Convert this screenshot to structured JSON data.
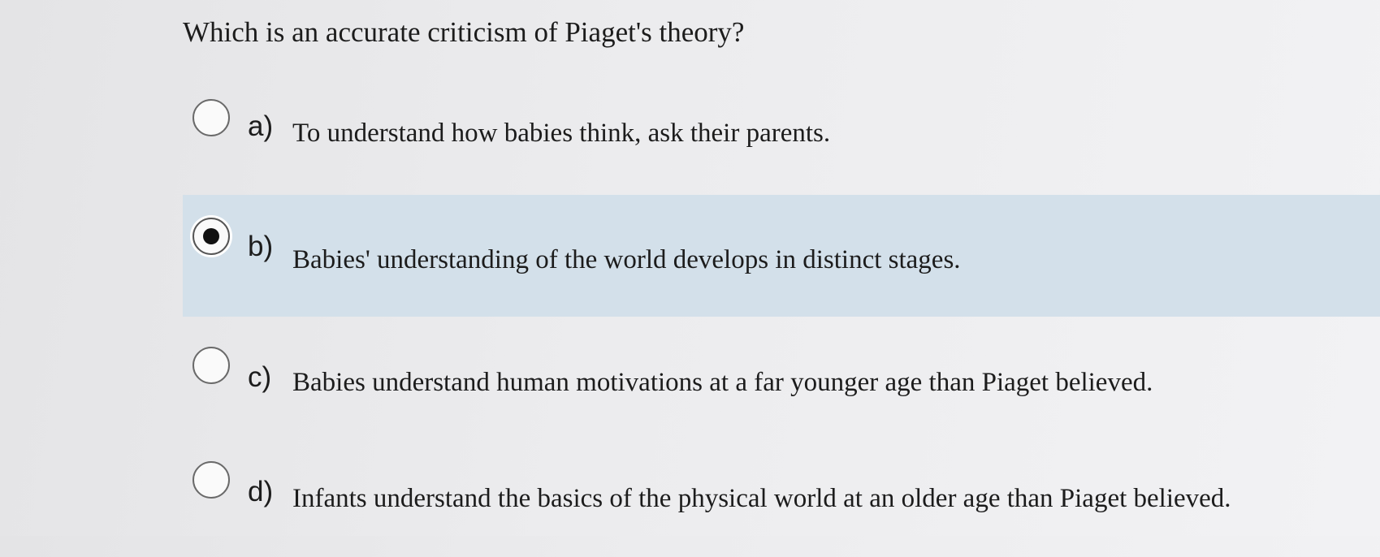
{
  "question": {
    "text": "Which is an accurate criticism of Piaget's theory?"
  },
  "options": [
    {
      "letter": "a)",
      "text": "To understand how babies think, ask their parents.",
      "selected": false
    },
    {
      "letter": "b)",
      "text": "Babies' understanding of the world develops in distinct stages.",
      "selected": true
    },
    {
      "letter": "c)",
      "text": "Babies understand human motivations at a far younger age than Piaget believed.",
      "selected": false
    },
    {
      "letter": "d)",
      "text": "Infants understand the basics of the physical world at an older age than Piaget believed.",
      "selected": false
    }
  ],
  "colors": {
    "selected_background": "#d3e0ea",
    "radio_border": "#6a6a6a",
    "radio_fill": "#111111"
  }
}
